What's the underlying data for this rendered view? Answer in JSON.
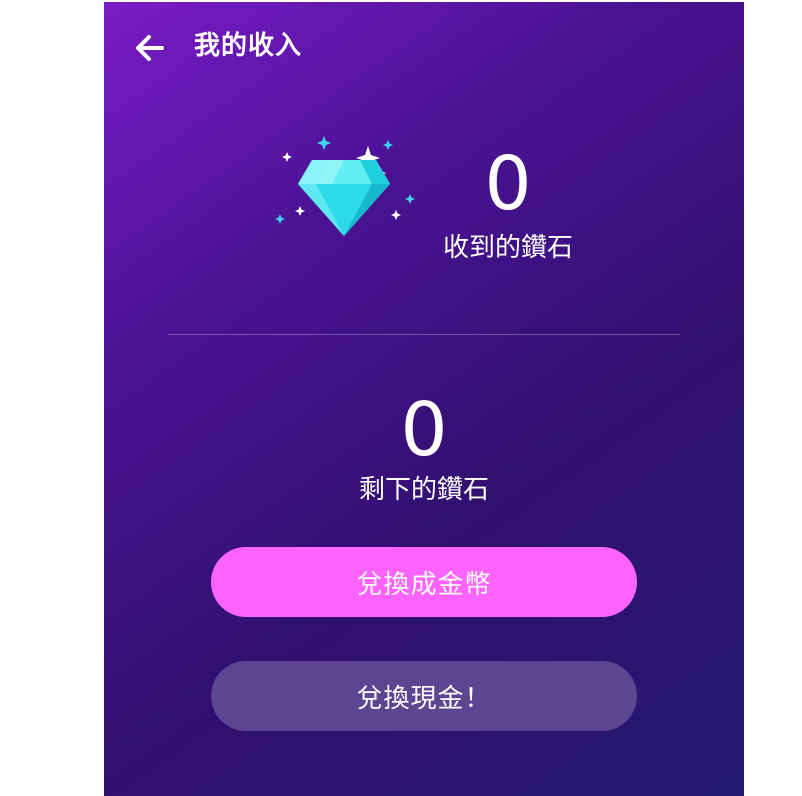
{
  "header": {
    "title": "我的收入",
    "back_icon": "arrow-left-icon"
  },
  "received": {
    "value": "0",
    "label": "收到的鑽石",
    "icon": "diamond-icon"
  },
  "remaining": {
    "value": "0",
    "label": "剩下的鑽石"
  },
  "actions": {
    "exchange_coins_label": "兌換成金幣",
    "exchange_cash_label": "兌換現金！"
  },
  "colors": {
    "primary_button": "#ff63ff",
    "secondary_button": "#5c4591",
    "diamond": "#3fe6f0"
  }
}
